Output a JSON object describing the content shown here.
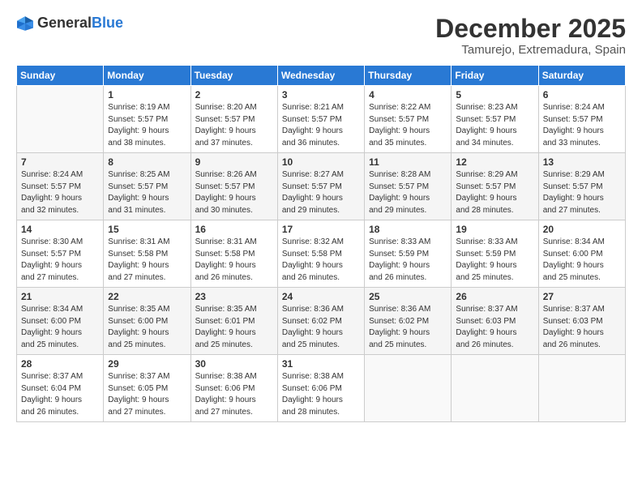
{
  "logo": {
    "general": "General",
    "blue": "Blue"
  },
  "title": "December 2025",
  "location": "Tamurejo, Extremadura, Spain",
  "header_days": [
    "Sunday",
    "Monday",
    "Tuesday",
    "Wednesday",
    "Thursday",
    "Friday",
    "Saturday"
  ],
  "weeks": [
    [
      {
        "day": "",
        "text": ""
      },
      {
        "day": "1",
        "text": "Sunrise: 8:19 AM\nSunset: 5:57 PM\nDaylight: 9 hours\nand 38 minutes."
      },
      {
        "day": "2",
        "text": "Sunrise: 8:20 AM\nSunset: 5:57 PM\nDaylight: 9 hours\nand 37 minutes."
      },
      {
        "day": "3",
        "text": "Sunrise: 8:21 AM\nSunset: 5:57 PM\nDaylight: 9 hours\nand 36 minutes."
      },
      {
        "day": "4",
        "text": "Sunrise: 8:22 AM\nSunset: 5:57 PM\nDaylight: 9 hours\nand 35 minutes."
      },
      {
        "day": "5",
        "text": "Sunrise: 8:23 AM\nSunset: 5:57 PM\nDaylight: 9 hours\nand 34 minutes."
      },
      {
        "day": "6",
        "text": "Sunrise: 8:24 AM\nSunset: 5:57 PM\nDaylight: 9 hours\nand 33 minutes."
      }
    ],
    [
      {
        "day": "7",
        "text": "Sunrise: 8:24 AM\nSunset: 5:57 PM\nDaylight: 9 hours\nand 32 minutes."
      },
      {
        "day": "8",
        "text": "Sunrise: 8:25 AM\nSunset: 5:57 PM\nDaylight: 9 hours\nand 31 minutes."
      },
      {
        "day": "9",
        "text": "Sunrise: 8:26 AM\nSunset: 5:57 PM\nDaylight: 9 hours\nand 30 minutes."
      },
      {
        "day": "10",
        "text": "Sunrise: 8:27 AM\nSunset: 5:57 PM\nDaylight: 9 hours\nand 29 minutes."
      },
      {
        "day": "11",
        "text": "Sunrise: 8:28 AM\nSunset: 5:57 PM\nDaylight: 9 hours\nand 29 minutes."
      },
      {
        "day": "12",
        "text": "Sunrise: 8:29 AM\nSunset: 5:57 PM\nDaylight: 9 hours\nand 28 minutes."
      },
      {
        "day": "13",
        "text": "Sunrise: 8:29 AM\nSunset: 5:57 PM\nDaylight: 9 hours\nand 27 minutes."
      }
    ],
    [
      {
        "day": "14",
        "text": "Sunrise: 8:30 AM\nSunset: 5:57 PM\nDaylight: 9 hours\nand 27 minutes."
      },
      {
        "day": "15",
        "text": "Sunrise: 8:31 AM\nSunset: 5:58 PM\nDaylight: 9 hours\nand 27 minutes."
      },
      {
        "day": "16",
        "text": "Sunrise: 8:31 AM\nSunset: 5:58 PM\nDaylight: 9 hours\nand 26 minutes."
      },
      {
        "day": "17",
        "text": "Sunrise: 8:32 AM\nSunset: 5:58 PM\nDaylight: 9 hours\nand 26 minutes."
      },
      {
        "day": "18",
        "text": "Sunrise: 8:33 AM\nSunset: 5:59 PM\nDaylight: 9 hours\nand 26 minutes."
      },
      {
        "day": "19",
        "text": "Sunrise: 8:33 AM\nSunset: 5:59 PM\nDaylight: 9 hours\nand 25 minutes."
      },
      {
        "day": "20",
        "text": "Sunrise: 8:34 AM\nSunset: 6:00 PM\nDaylight: 9 hours\nand 25 minutes."
      }
    ],
    [
      {
        "day": "21",
        "text": "Sunrise: 8:34 AM\nSunset: 6:00 PM\nDaylight: 9 hours\nand 25 minutes."
      },
      {
        "day": "22",
        "text": "Sunrise: 8:35 AM\nSunset: 6:00 PM\nDaylight: 9 hours\nand 25 minutes."
      },
      {
        "day": "23",
        "text": "Sunrise: 8:35 AM\nSunset: 6:01 PM\nDaylight: 9 hours\nand 25 minutes."
      },
      {
        "day": "24",
        "text": "Sunrise: 8:36 AM\nSunset: 6:02 PM\nDaylight: 9 hours\nand 25 minutes."
      },
      {
        "day": "25",
        "text": "Sunrise: 8:36 AM\nSunset: 6:02 PM\nDaylight: 9 hours\nand 25 minutes."
      },
      {
        "day": "26",
        "text": "Sunrise: 8:37 AM\nSunset: 6:03 PM\nDaylight: 9 hours\nand 26 minutes."
      },
      {
        "day": "27",
        "text": "Sunrise: 8:37 AM\nSunset: 6:03 PM\nDaylight: 9 hours\nand 26 minutes."
      }
    ],
    [
      {
        "day": "28",
        "text": "Sunrise: 8:37 AM\nSunset: 6:04 PM\nDaylight: 9 hours\nand 26 minutes."
      },
      {
        "day": "29",
        "text": "Sunrise: 8:37 AM\nSunset: 6:05 PM\nDaylight: 9 hours\nand 27 minutes."
      },
      {
        "day": "30",
        "text": "Sunrise: 8:38 AM\nSunset: 6:06 PM\nDaylight: 9 hours\nand 27 minutes."
      },
      {
        "day": "31",
        "text": "Sunrise: 8:38 AM\nSunset: 6:06 PM\nDaylight: 9 hours\nand 28 minutes."
      },
      {
        "day": "",
        "text": ""
      },
      {
        "day": "",
        "text": ""
      },
      {
        "day": "",
        "text": ""
      }
    ]
  ]
}
